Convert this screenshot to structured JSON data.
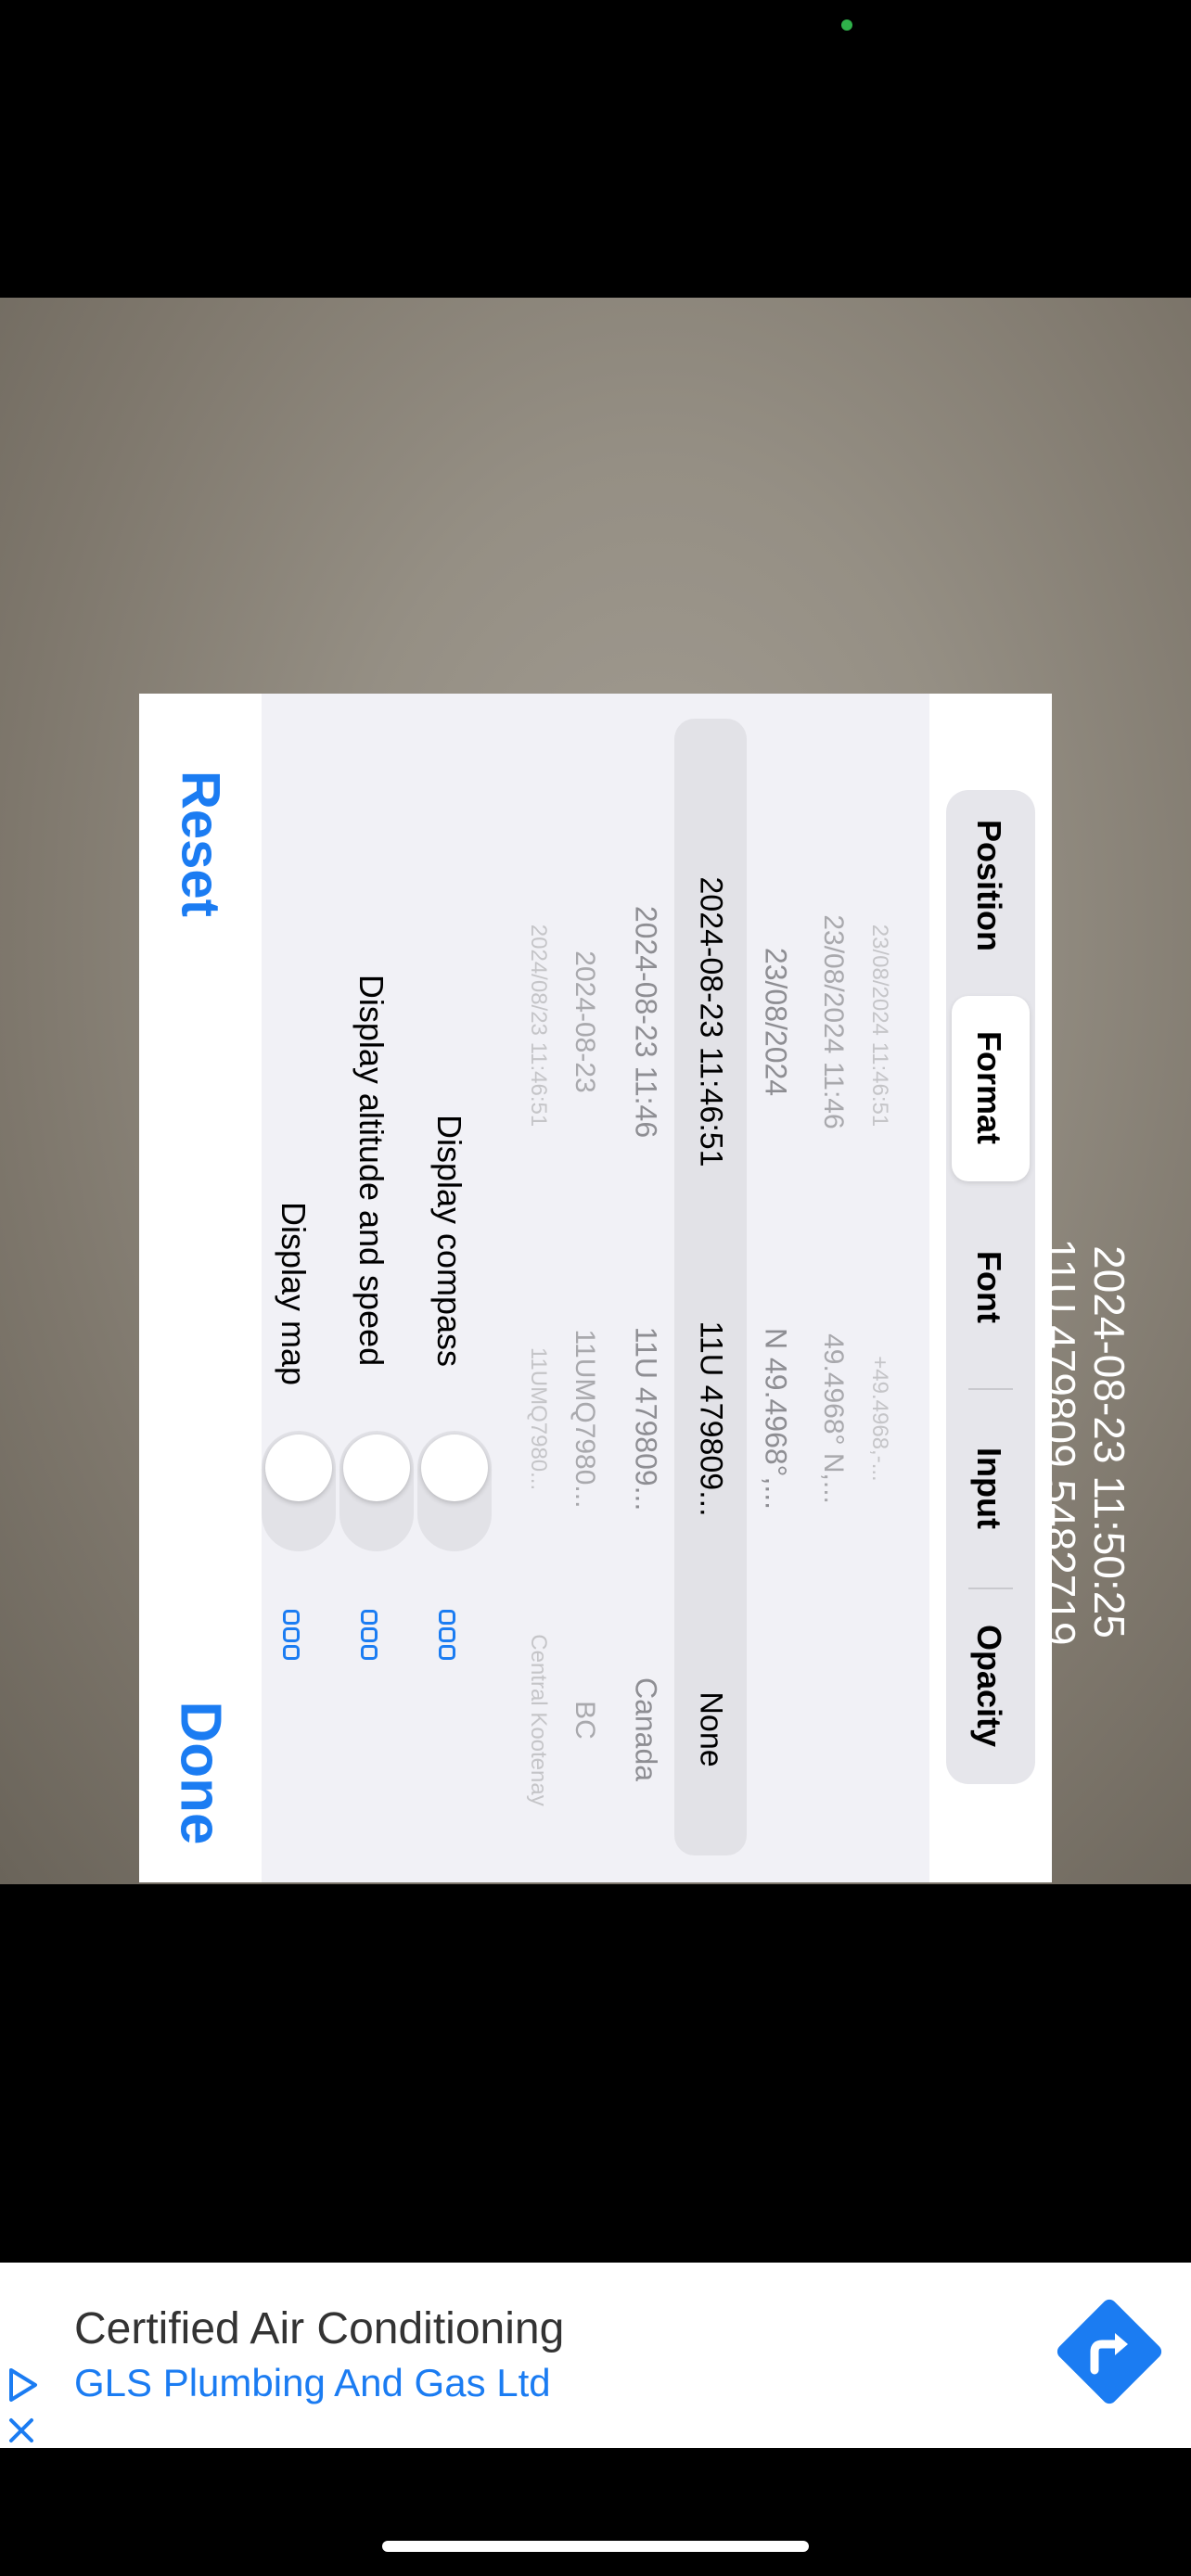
{
  "overlay": {
    "line1": "2024-08-23 11:50:25",
    "line2": "11U 479809 5482719"
  },
  "tabs": [
    "Position",
    "Format",
    "Font",
    "Input",
    "Opacity"
  ],
  "selected_tab": "Format",
  "format_rows": [
    {
      "date": "23/08/2024 11:46:51",
      "pos": "+49.4968,-...",
      "loc": ""
    },
    {
      "date": "23/08/2024 11:46",
      "pos": "49.4968° N,...",
      "loc": ""
    },
    {
      "date": "23/08/2024",
      "pos": "N 49.4968°,...",
      "loc": ""
    },
    {
      "date": "2024-08-23 11:46:51",
      "pos": "11U 479809...",
      "loc": "None"
    },
    {
      "date": "2024-08-23 11:46",
      "pos": "11U 479809...",
      "loc": "Canada"
    },
    {
      "date": "2024-08-23",
      "pos": "11UMQ7980...",
      "loc": "BC"
    },
    {
      "date": "2024/08/23 11:46:51",
      "pos": "11UMQ7980...",
      "loc": "Central Kootenay"
    }
  ],
  "options": [
    {
      "label": "Display compass"
    },
    {
      "label": "Display altitude and speed"
    },
    {
      "label": "Display map"
    }
  ],
  "buttons": {
    "reset": "Reset",
    "done": "Done"
  },
  "ad": {
    "title": "Certified Air Conditioning",
    "advertiser": "GLS Plumbing And Gas Ltd"
  },
  "colors": {
    "accent": "#1b7cf2"
  }
}
